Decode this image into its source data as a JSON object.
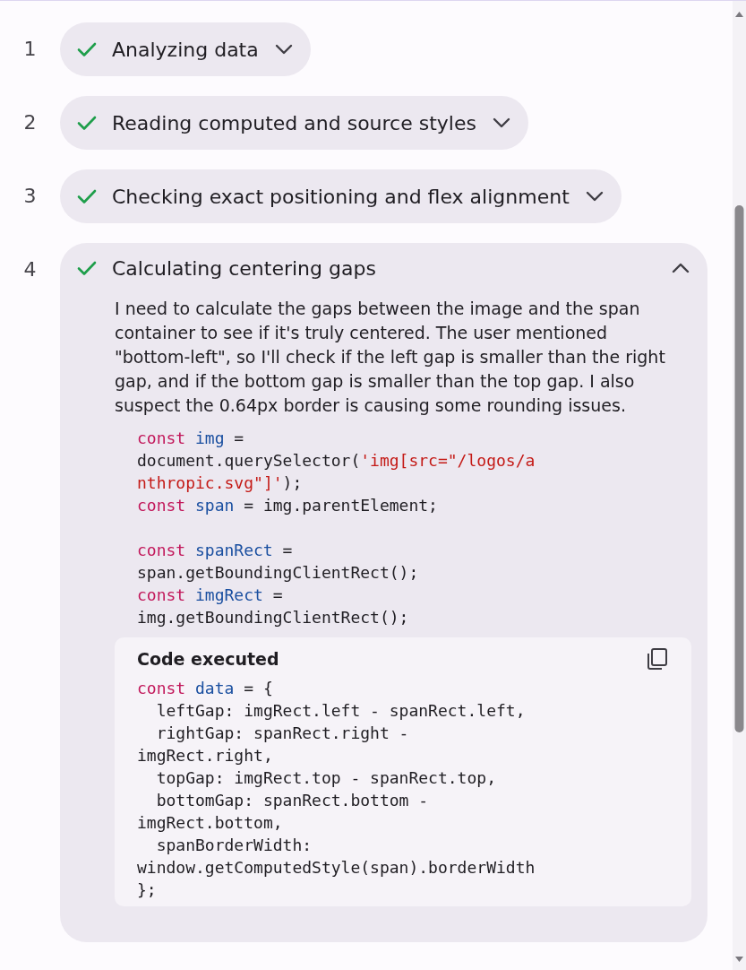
{
  "steps": [
    {
      "number": "1",
      "title": "Analyzing data",
      "done": true,
      "expanded": false
    },
    {
      "number": "2",
      "title": "Reading computed and source styles",
      "done": true,
      "expanded": false
    },
    {
      "number": "3",
      "title": "Checking exact positioning and flex alignment",
      "done": true,
      "expanded": false
    },
    {
      "number": "4",
      "title": "Calculating centering gaps",
      "done": true,
      "expanded": true,
      "paragraph": "I need to calculate the gaps between the image and the span container to see if it's truly centered. The user mentioned \"bottom-left\", so I'll check if the left gap is smaller than the right gap, and if the bottom gap is smaller than the top gap. I also suspect the 0.64px border is causing some rounding issues.",
      "code_lines": [
        {
          "tokens": [
            {
              "kind": "keyword",
              "text": "const"
            },
            {
              "kind": "name",
              "text": "img"
            },
            {
              "kind": "plain",
              "text": " ="
            }
          ]
        },
        {
          "tokens": [
            {
              "kind": "plain",
              "text": "document.querySelector("
            },
            {
              "kind": "string",
              "text": "'img[src=\"/logos/a"
            }
          ]
        },
        {
          "tokens": [
            {
              "kind": "string",
              "text": "nthropic.svg\"]'"
            },
            {
              "kind": "plain",
              "text": ");"
            }
          ]
        },
        {
          "tokens": [
            {
              "kind": "keyword",
              "text": "const"
            },
            {
              "kind": "name",
              "text": "span"
            },
            {
              "kind": "plain",
              "text": " = img.parentElement;"
            }
          ]
        },
        {
          "gap_before": true,
          "tokens": [
            {
              "kind": "keyword",
              "text": "const"
            },
            {
              "kind": "name",
              "text": "spanRect"
            },
            {
              "kind": "plain",
              "text": " ="
            }
          ]
        },
        {
          "tokens": [
            {
              "kind": "plain",
              "text": "span.getBoundingClientRect();"
            }
          ]
        },
        {
          "tokens": [
            {
              "kind": "keyword",
              "text": "const"
            },
            {
              "kind": "name",
              "text": "imgRect"
            },
            {
              "kind": "plain",
              "text": " ="
            }
          ]
        },
        {
          "tokens": [
            {
              "kind": "plain",
              "text": "img.getBoundingClientRect();"
            }
          ]
        }
      ],
      "result": {
        "title": "Code executed",
        "lines": [
          {
            "tokens": [
              {
                "kind": "keyword",
                "text": "const"
              },
              {
                "kind": "name",
                "text": "data"
              },
              {
                "kind": "plain",
                "text": " = {"
              }
            ]
          },
          {
            "tokens": [
              {
                "kind": "plain",
                "text": "  leftGap: imgRect.left - spanRect.left,"
              }
            ]
          },
          {
            "tokens": [
              {
                "kind": "plain",
                "text": "  rightGap: spanRect.right -"
              }
            ]
          },
          {
            "tokens": [
              {
                "kind": "plain",
                "text": "imgRect.right,"
              }
            ]
          },
          {
            "tokens": [
              {
                "kind": "plain",
                "text": "  topGap: imgRect.top - spanRect.top,"
              }
            ]
          },
          {
            "tokens": [
              {
                "kind": "plain",
                "text": "  bottomGap: spanRect.bottom -"
              }
            ]
          },
          {
            "tokens": [
              {
                "kind": "plain",
                "text": "imgRect.bottom,"
              }
            ]
          },
          {
            "tokens": [
              {
                "kind": "plain",
                "text": "  spanBorderWidth:"
              }
            ]
          },
          {
            "tokens": [
              {
                "kind": "plain",
                "text": "window.getComputedStyle(span).borderWidth"
              }
            ]
          },
          {
            "tokens": [
              {
                "kind": "plain",
                "text": "};"
              }
            ]
          }
        ]
      }
    }
  ]
}
